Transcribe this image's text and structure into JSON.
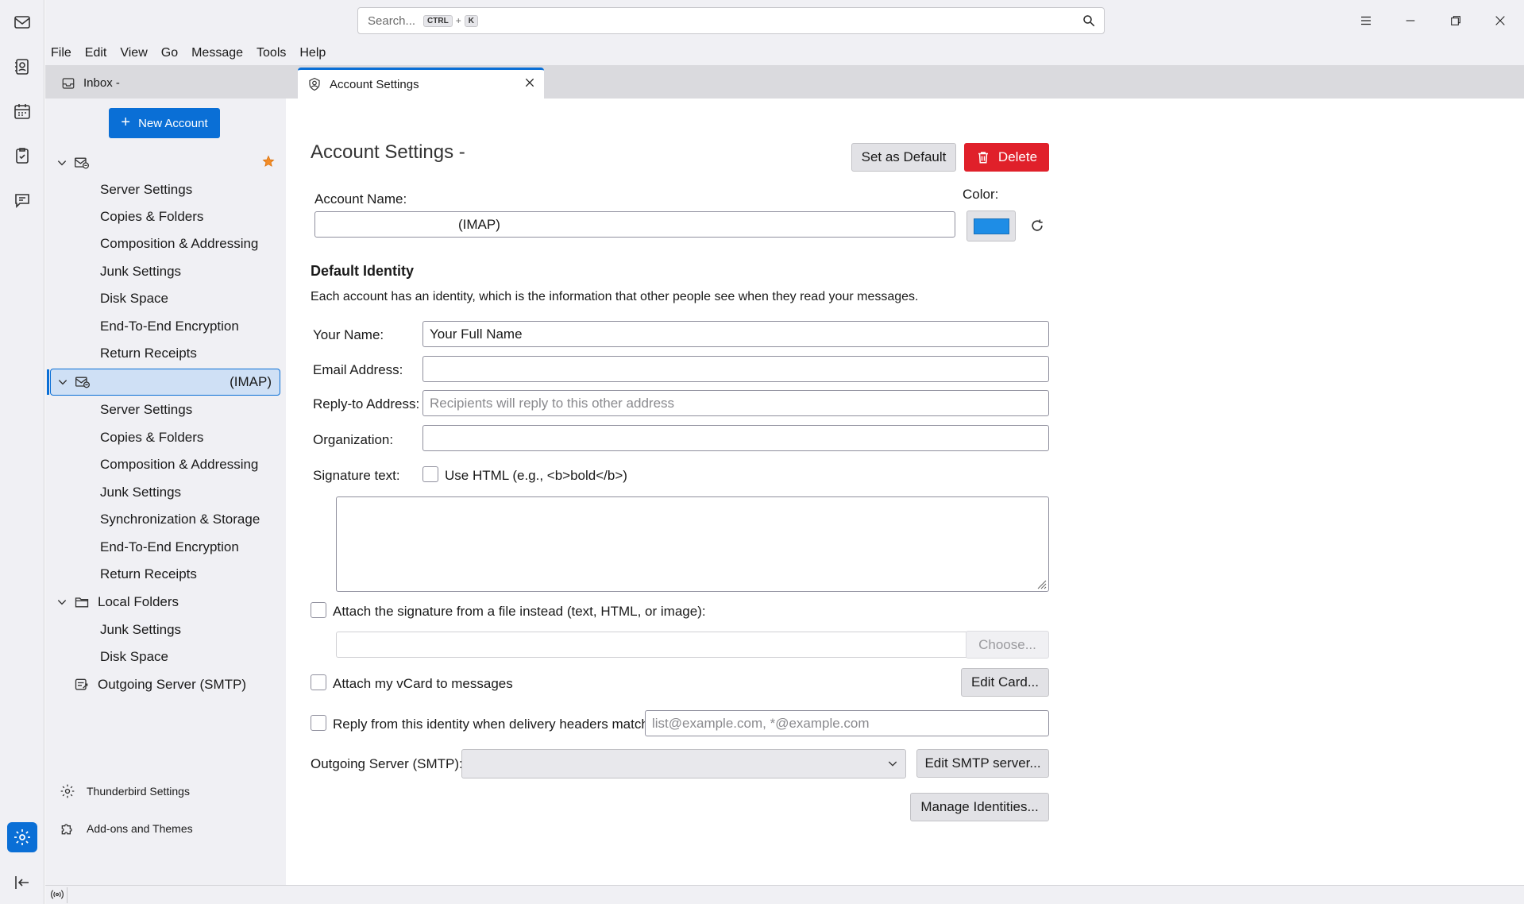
{
  "search": {
    "placeholder": "Search...",
    "kbd1": "CTRL",
    "plus": "+",
    "kbd2": "K"
  },
  "menu": {
    "file": "File",
    "edit": "Edit",
    "view": "View",
    "go": "Go",
    "message": "Message",
    "tools": "Tools",
    "help": "Help"
  },
  "tabs": {
    "inbox": "Inbox - ",
    "account": "Account Settings"
  },
  "sidebar": {
    "new_account": "New Account",
    "account1_children": [
      "Server Settings",
      "Copies & Folders",
      "Composition & Addressing",
      "Junk Settings",
      "Disk Space",
      "End-To-End Encryption",
      "Return Receipts"
    ],
    "account2_label": "(IMAP)",
    "account2_children": [
      "Server Settings",
      "Copies & Folders",
      "Composition & Addressing",
      "Junk Settings",
      "Synchronization & Storage",
      "End-To-End Encryption",
      "Return Receipts"
    ],
    "local_folders": "Local Folders",
    "local_children": [
      "Junk Settings",
      "Disk Space"
    ],
    "outgoing": "Outgoing Server (SMTP)",
    "tb_settings": "Thunderbird Settings",
    "addons": "Add-ons and Themes"
  },
  "main": {
    "title": "Account Settings -",
    "set_default": "Set as Default",
    "delete": "Delete",
    "account_name_label": "Account Name:",
    "account_name_value": "(IMAP)",
    "color_label": "Color:",
    "color_value": "#1e8de6",
    "default_identity": "Default Identity",
    "identity_desc": "Each account has an identity, which is the information that other people see when they read your messages.",
    "your_name_label": "Your Name:",
    "your_name_value": "Your Full Name",
    "email_label": "Email Address:",
    "email_value": "",
    "reply_to_label": "Reply-to Address:",
    "reply_to_placeholder": "Recipients will reply to this other address",
    "org_label": "Organization:",
    "org_value": "",
    "sig_label": "Signature text:",
    "use_html": "Use HTML (e.g., <b>bold</b>)",
    "attach_sig": "Attach the signature from a file instead (text, HTML, or image):",
    "choose": "Choose...",
    "attach_vcard": "Attach my vCard to messages",
    "edit_card": "Edit Card...",
    "reply_from": "Reply from this identity when delivery headers match:",
    "reply_from_placeholder": "list@example.com, *@example.com",
    "outgoing_label": "Outgoing Server (SMTP):",
    "outgoing_value": "",
    "edit_smtp": "Edit SMTP server...",
    "manage_identities": "Manage Identities..."
  }
}
